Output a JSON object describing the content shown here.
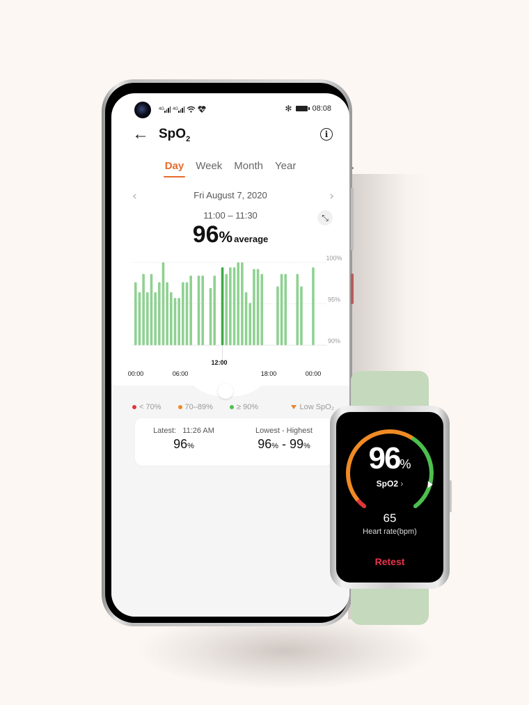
{
  "colors": {
    "accent": "#e56c2c",
    "bar": "#8fd192",
    "bar_selected": "#3faa46",
    "low_red": "#e0363a",
    "mid_orange": "#f08a24",
    "high_green": "#4cbf4f",
    "retest": "#e8344c",
    "band": "#c5d9bd"
  },
  "status_bar": {
    "signal1": "4G",
    "signal2": "4G",
    "time": "08:08",
    "icons": [
      "signal-icon",
      "signal-icon",
      "wifi-icon",
      "health-heart-icon",
      "bluetooth-icon",
      "battery-icon"
    ]
  },
  "header": {
    "title": "SpO",
    "title_sub": "2",
    "back_icon": "←",
    "info_icon": "i"
  },
  "tabs": [
    {
      "label": "Day",
      "active": true
    },
    {
      "label": "Week",
      "active": false
    },
    {
      "label": "Month",
      "active": false
    },
    {
      "label": "Year",
      "active": false
    }
  ],
  "date_nav": {
    "date": "Fri August 7, 2020",
    "prev_icon": "‹",
    "next_icon": "›"
  },
  "selection": {
    "time_range": "11:00 – 11:30",
    "value": "96",
    "unit": "%",
    "label": "average",
    "expand_icon": "⤡"
  },
  "chart_data": {
    "type": "bar",
    "title": "",
    "xlabel": "",
    "ylabel": "",
    "ylim": [
      90,
      100
    ],
    "y_ticks": [
      "100%",
      "95%",
      "90%"
    ],
    "y_tick_values": [
      100,
      95,
      90
    ],
    "x_ticks": [
      "00:00",
      "06:00",
      "12:00",
      "18:00",
      "00:00"
    ],
    "x_tick_hours": [
      0,
      6,
      12,
      18,
      24
    ],
    "highlighted_tick": "12:00",
    "slot_minutes": 30,
    "selected_slot": 22,
    "values": [
      97.6,
      96.4,
      98.6,
      96.4,
      98.6,
      96.4,
      97.6,
      100,
      97.6,
      96.4,
      95.7,
      95.7,
      97.6,
      97.6,
      98.4,
      null,
      98.4,
      98.4,
      null,
      96.9,
      98.4,
      null,
      99.4,
      98.6,
      99.4,
      99.4,
      100,
      100,
      96.4,
      95.1,
      99.2,
      99.2,
      98.6,
      null,
      null,
      null,
      97.1,
      98.6,
      98.6,
      null,
      null,
      98.6,
      97.1,
      null,
      null,
      99.4
    ],
    "grid": true
  },
  "legend": [
    {
      "label": "< 70%",
      "color": "#e0363a",
      "shape": "dot"
    },
    {
      "label": "70–89%",
      "color": "#f08a24",
      "shape": "dot"
    },
    {
      "label": "≥ 90%",
      "color": "#4cbf4f",
      "shape": "dot"
    },
    {
      "label": "Low SpO₂",
      "color": "#e8852c",
      "shape": "triangle"
    }
  ],
  "summary": {
    "latest_label": "Latest:",
    "latest_time": "11:26 AM",
    "latest_value": "96",
    "range_label": "Lowest - Highest",
    "lowest_value": "96",
    "highest_value": "99",
    "unit": "%"
  },
  "watch": {
    "value": "96",
    "unit": "%",
    "label": "SpO2",
    "label_chevron": "›",
    "heart_rate": "65",
    "heart_rate_label": "Heart rate(bpm)",
    "retest_label": "Retest",
    "gauge_value_percent": 96
  }
}
